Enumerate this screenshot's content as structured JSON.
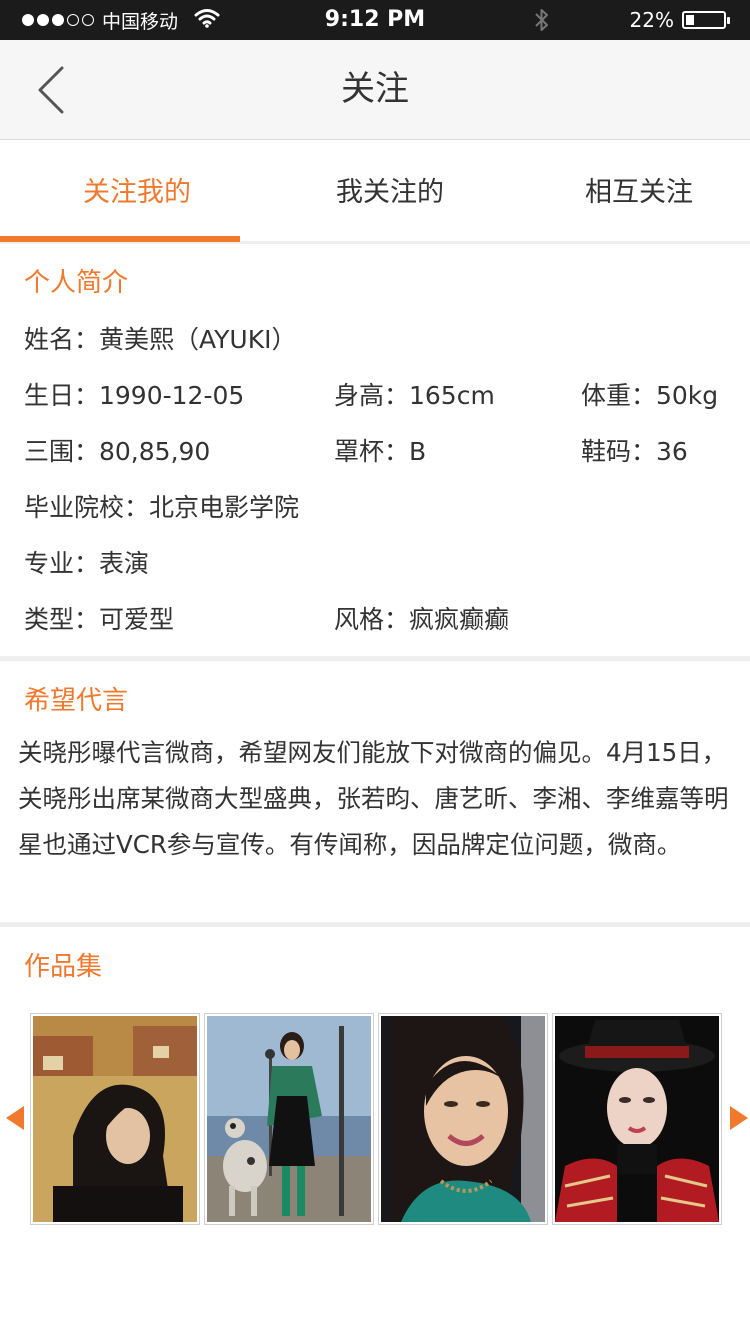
{
  "status_bar": {
    "signal_filled": 3,
    "signal_total": 5,
    "carrier": "中国移动",
    "time": "9:12 PM",
    "battery_percent": "22%",
    "battery_level": 0.22
  },
  "nav": {
    "title": "关注"
  },
  "tabs": [
    {
      "label": "关注我的",
      "active": true
    },
    {
      "label": "我关注的",
      "active": false
    },
    {
      "label": "相互关注",
      "active": false
    }
  ],
  "profile": {
    "section_title": "个人简介",
    "name": "姓名：黄美熙（AYUKI）",
    "birthday": "生日：1990-12-05",
    "height": "身高：165cm",
    "weight": "体重：50kg",
    "measurements": "三围：80,85,90",
    "cup": "罩杯：B",
    "shoe_size": "鞋码：36",
    "school": "毕业院校：北京电影学院",
    "major": "专业：表演",
    "type": "类型：可爱型",
    "style": "风格：疯疯癫癫"
  },
  "endorsement": {
    "section_title": "希望代言",
    "text": "关晓彤曝代言微商，希望网友们能放下对微商的偏见。4月15日，关晓彤出席某微商大型盛典，张若昀、唐艺昕、李湘、李维嘉等明星也通过VCR参与宣传。有传闻称，因品牌定位问题，微商。"
  },
  "portfolio": {
    "section_title": "作品集",
    "photos": [
      {
        "subject": "portrait-dark-hair-rooftops"
      },
      {
        "subject": "woman-with-dog-street"
      },
      {
        "subject": "smiling-woman-green-top"
      },
      {
        "subject": "woman-black-hat-red-jacket"
      }
    ]
  },
  "colors": {
    "accent": "#f0792e",
    "status_bar_bg": "#1b1b1b",
    "nav_bg": "#f6f6f6",
    "divider": "#eeeeee",
    "text": "#333333"
  },
  "icons": {
    "back": "chevron-left-icon",
    "prev": "triangle-left-icon",
    "next": "triangle-right-icon",
    "wifi": "wifi-icon",
    "bluetooth": "bluetooth-icon",
    "battery": "battery-icon"
  }
}
